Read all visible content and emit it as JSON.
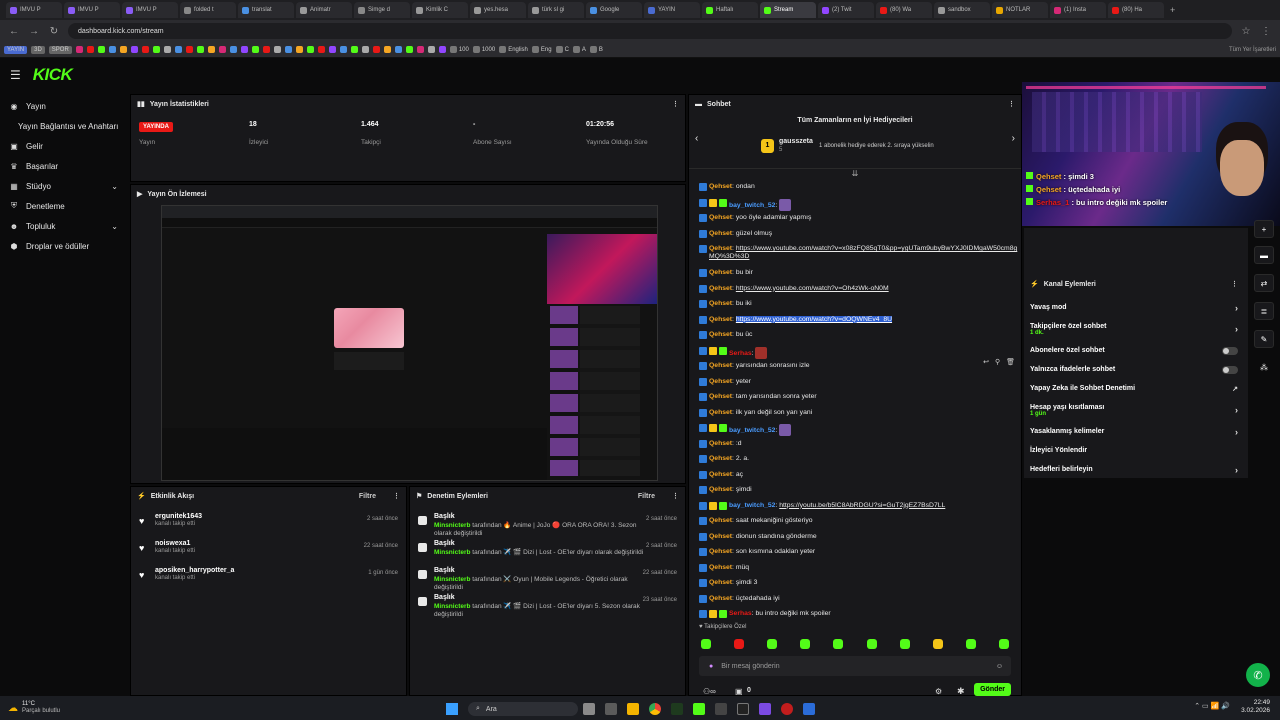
{
  "browser": {
    "tabs": [
      {
        "label": "IMVU P",
        "color": "#8a5cf6"
      },
      {
        "label": "IMVU P",
        "color": "#8a5cf6"
      },
      {
        "label": "IMVU P",
        "color": "#8a5cf6"
      },
      {
        "label": "folded t",
        "color": "#888"
      },
      {
        "label": "translat",
        "color": "#4a90e2"
      },
      {
        "label": "Animatr",
        "color": "#999"
      },
      {
        "label": "Simge d",
        "color": "#888"
      },
      {
        "label": "Kimlik C",
        "color": "#999"
      },
      {
        "label": "yes.hesa",
        "color": "#999"
      },
      {
        "label": "türk sl gi",
        "color": "#999"
      },
      {
        "label": "Google",
        "color": "#4a90e2"
      },
      {
        "label": "YAYIN",
        "color": "#4a6bd1"
      },
      {
        "label": "Haftalı",
        "color": "#53fc18"
      },
      {
        "label": "Stream",
        "color": "#53fc18"
      },
      {
        "label": "(2) Twit",
        "color": "#9146ff"
      },
      {
        "label": "(80) Wa",
        "color": "#e91916"
      },
      {
        "label": "sandbox",
        "color": "#999"
      },
      {
        "label": "NOTLAR",
        "color": "#e8a700"
      },
      {
        "label": "(1) Insta",
        "color": "#d62976"
      },
      {
        "label": "(80) Ha",
        "color": "#e91916"
      }
    ],
    "url": "dashboard.kick.com/stream",
    "bookmarks_left": [
      "YAYIN",
      "3D",
      "SPOR"
    ],
    "bookmarks_named": [
      "100",
      "1000",
      "English",
      "Eng",
      "C",
      "A",
      "B"
    ],
    "bookmarks_right": "Tüm Yer İşaretleri"
  },
  "topnav": {
    "logo": "KICK"
  },
  "leftnav": {
    "items": [
      {
        "label": "Yayın",
        "icon": "broadcast-icon"
      },
      {
        "label": "Yayın Bağlantısı ve Anahtarı",
        "icon": ""
      },
      {
        "label": "Gelir",
        "icon": "money-icon"
      },
      {
        "label": "Başarılar",
        "icon": "trophy-icon"
      },
      {
        "label": "Stüdyo",
        "icon": "studio-icon"
      },
      {
        "label": "Denetleme",
        "icon": "shield-icon"
      },
      {
        "label": "Topluluk",
        "icon": "community-icon"
      },
      {
        "label": "Droplar ve ödüller",
        "icon": "drops-icon"
      }
    ]
  },
  "stats": {
    "title": "Yayın İstatistikleri",
    "live_badge": "YAYINDA",
    "live_label": "Yayın",
    "viewers": "18",
    "viewers_label": "İzleyici",
    "followers": "1.464",
    "followers_label": "Takipçi",
    "subs": "-",
    "subs_label": "Abone Sayısı",
    "uptime": "01:20:56",
    "uptime_label": "Yayında Olduğu Süre"
  },
  "preview": {
    "title": "Yayın Ön İzlemesi"
  },
  "activity": {
    "title": "Etkinlik Akışı",
    "filter": "Filtre",
    "items": [
      {
        "user": "ergunitek1643",
        "action": "kanalı takip etti",
        "time": "2 saat önce"
      },
      {
        "user": "noiswexa1",
        "action": "kanalı takip etti",
        "time": "22 saat önce"
      },
      {
        "user": "aposiken_harrypotter_a",
        "action": "kanalı takip etti",
        "time": "1 gün önce"
      }
    ]
  },
  "modactions": {
    "title": "Denetim Eylemleri",
    "filter": "Filtre",
    "items": [
      {
        "title": "Başlık",
        "by": "Minsnicterb",
        "text": "tarafından 🔥 Anime | JoJo 🔴 ORA ORA ORA! 3. Sezon olarak değiştirildi",
        "time": "2 saat önce"
      },
      {
        "title": "Başlık",
        "by": "Minsnicterb",
        "text": "tarafından ✈️ 🎬 Dizi | Lost - OE'ler diyarı olarak değiştirildi",
        "time": "2 saat önce"
      },
      {
        "title": "Başlık",
        "by": "Minsnicterb",
        "text": "tarafından ⚔️ Oyun | Mobile Legends - Öğretici olarak değiştirildi",
        "time": "22 saat önce"
      },
      {
        "title": "Başlık",
        "by": "Minsnicterb",
        "text": "tarafından ✈️ 🎬 Dizi | Lost - OE'ler diyarı 5. Sezon olarak değiştirildi",
        "time": "23 saat önce"
      }
    ]
  },
  "chat": {
    "title": "Sohbet",
    "gifter_title": "Tüm Zamanların en İyi Hediyecileri",
    "gifter_name": "gausszeta",
    "gifter_count": "5",
    "gifter_rank": "1",
    "gifter_note": "1 abonelik hediye ederek 2. sıraya yükselin",
    "messages": [
      {
        "user": "Qehset",
        "color": "#f5a623",
        "text": "ondan",
        "link": false
      },
      {
        "user": "bay_twitch_52",
        "color": "#4a9cff",
        "text": "",
        "link": false,
        "emote": true
      },
      {
        "user": "Qehset",
        "color": "#f5a623",
        "text": "yoo öyle adamlar yapmış",
        "link": false
      },
      {
        "user": "Qehset",
        "color": "#f5a623",
        "text": "güzel olmuş",
        "link": false
      },
      {
        "user": "Qehset",
        "color": "#f5a623",
        "text": "https://www.youtube.com/watch?v=x08zFQ85qT0&pp=ygUTam9ubyBwYXJ0IDMgaW50cm8gMQ%3D%3D",
        "link": true
      },
      {
        "user": "Qehset",
        "color": "#f5a623",
        "text": "bu bir",
        "link": false
      },
      {
        "user": "Qehset",
        "color": "#f5a623",
        "text": "https://www.youtube.com/watch?v=Oh4zWk-oN0M",
        "link": true
      },
      {
        "user": "Qehset",
        "color": "#f5a623",
        "text": "bu iki",
        "link": false
      },
      {
        "user": "Qehset",
        "color": "#f5a623",
        "text": "https://www.youtube.com/watch?v=dOQWNEv4_8U",
        "link": true,
        "highlight": true
      },
      {
        "user": "Qehset",
        "color": "#f5a623",
        "text": "bu üc",
        "link": false
      },
      {
        "user": "Serhas",
        "color": "#e91916",
        "text": "",
        "link": false,
        "emote": true
      },
      {
        "user": "Qehset",
        "color": "#f5a623",
        "text": "yarısından sonrasını izle",
        "link": false
      },
      {
        "user": "Qehset",
        "color": "#f5a623",
        "text": "yeter",
        "link": false
      },
      {
        "user": "Qehset",
        "color": "#f5a623",
        "text": "tam yarısından sonra yeter",
        "link": false
      },
      {
        "user": "Qehset",
        "color": "#f5a623",
        "text": "ilk yarı değil son yarı yani",
        "link": false
      },
      {
        "user": "bay_twitch_52",
        "color": "#4a9cff",
        "text": "",
        "link": false,
        "emote": true
      },
      {
        "user": "Qehset",
        "color": "#f5a623",
        "text": ":d",
        "link": false
      },
      {
        "user": "Qehset",
        "color": "#f5a623",
        "text": "2. a.",
        "link": false
      },
      {
        "user": "Qehset",
        "color": "#f5a623",
        "text": "aç",
        "link": false
      },
      {
        "user": "Qehset",
        "color": "#f5a623",
        "text": "şimdi",
        "link": false
      },
      {
        "user": "bay_twitch_52",
        "color": "#4a9cff",
        "text": "https://youtu.be/b5lC8AbRDGU?si=GuT2jgEZ7BsD7LL",
        "link": true
      },
      {
        "user": "Qehset",
        "color": "#f5a623",
        "text": "saat mekaniğini gösteriyo",
        "link": false
      },
      {
        "user": "Qehset",
        "color": "#f5a623",
        "text": "dionun standına gönderme",
        "link": false
      },
      {
        "user": "Qehset",
        "color": "#f5a623",
        "text": "son kısmına odaklan yeter",
        "link": false
      },
      {
        "user": "Qehset",
        "color": "#f5a623",
        "text": "müq",
        "link": false
      },
      {
        "user": "Qehset",
        "color": "#f5a623",
        "text": "şimdi 3",
        "link": false
      },
      {
        "user": "Qehset",
        "color": "#f5a623",
        "text": "üçtedahada iyi",
        "link": false
      },
      {
        "user": "Serhas",
        "color": "#e91916",
        "text": "bu intro değiki mk spoiler",
        "link": false
      }
    ],
    "followers_only": "Takipçilere Özel",
    "input_placeholder": "Bir mesaj gönderin",
    "viewer_count": "0",
    "send": "Gönder"
  },
  "overlay": {
    "lines": [
      {
        "user": "Qehset",
        "color": "#f5a623",
        "text": "şimdi 3"
      },
      {
        "user": "Qehset",
        "color": "#f5a623",
        "text": "üçtedahada iyi"
      },
      {
        "user": "Serhas_1",
        "color": "#e91916",
        "text": "bu intro değiki mk spoiler"
      }
    ]
  },
  "channel_actions": {
    "title": "Kanal Eylemleri",
    "items": [
      {
        "label": "Yavaş mod",
        "type": "arrow",
        "sub": ""
      },
      {
        "label": "Takipçilere özel sohbet",
        "type": "arrow",
        "sub": "1 dk."
      },
      {
        "label": "Abonelere özel sohbet",
        "type": "toggle",
        "sub": ""
      },
      {
        "label": "Yalnızca ifadelerle sohbet",
        "type": "toggle",
        "sub": ""
      },
      {
        "label": "Yapay Zeka ile Sohbet Denetimi",
        "type": "link",
        "sub": ""
      },
      {
        "label": "Hesap yaşı kısıtlaması",
        "type": "arrow",
        "sub": "1 gün"
      },
      {
        "label": "Yasaklanmış kelimeler",
        "type": "arrow",
        "sub": ""
      },
      {
        "label": "İzleyici Yönlendir",
        "type": "none",
        "sub": ""
      },
      {
        "label": "Hedefleri belirleyin",
        "type": "arrow",
        "sub": ""
      }
    ]
  },
  "taskbar": {
    "weather_temp": "11°C",
    "weather_desc": "Parçalı bulutlu",
    "search": "Ara",
    "time": "22:49",
    "date": "3.02.2026"
  }
}
